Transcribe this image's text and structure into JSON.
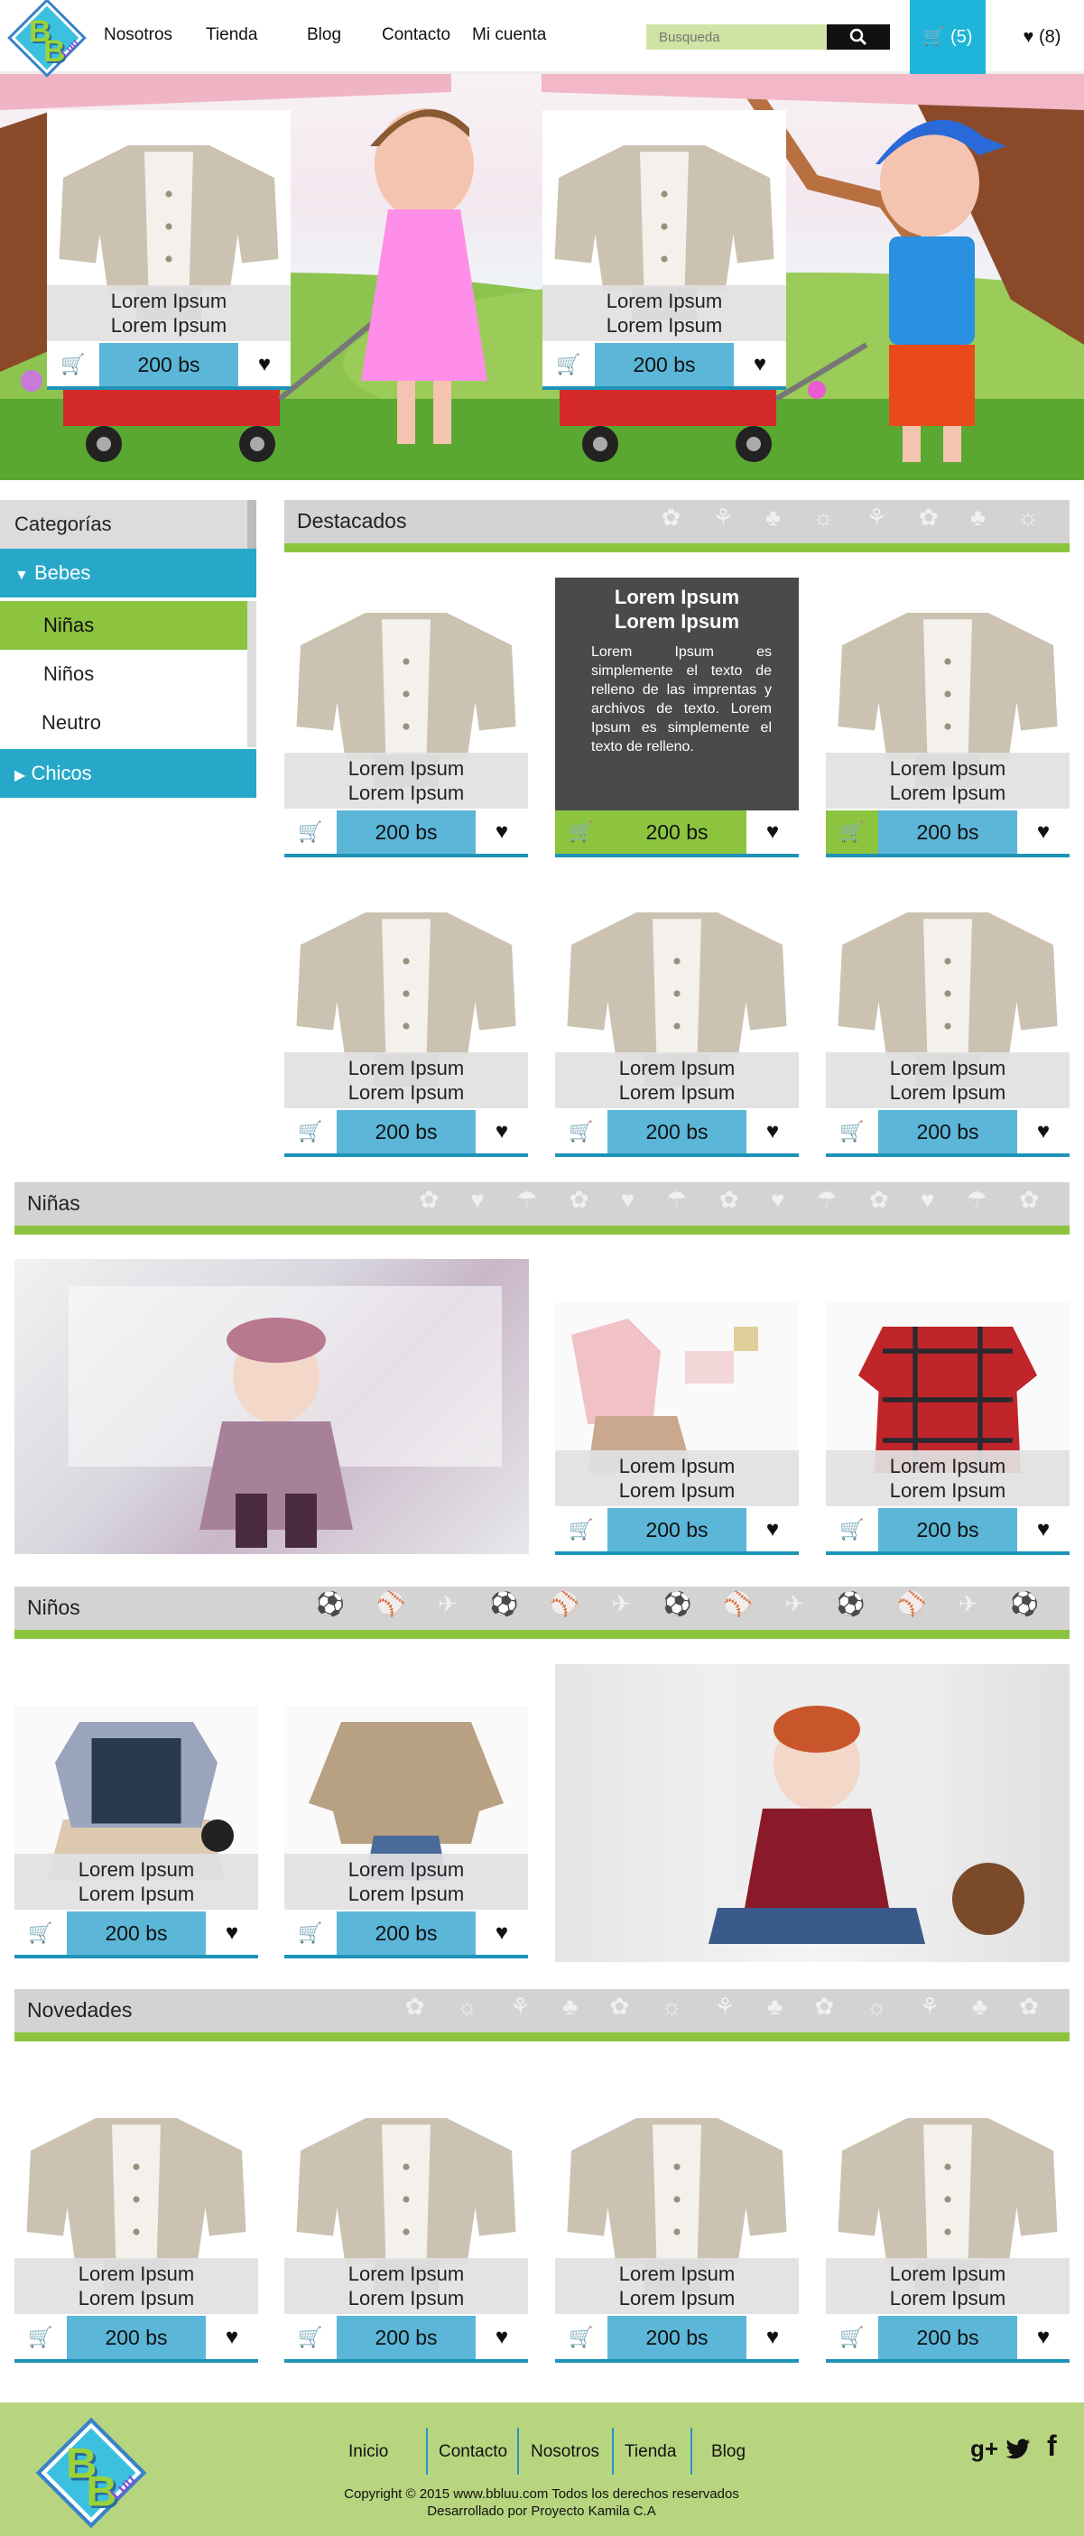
{
  "header": {
    "logo_text": "BBLuu",
    "nav": [
      "Nosotros",
      "Tienda",
      "Blog",
      "Contacto",
      "Mi cuenta"
    ],
    "search_placeholder": "Busqueda",
    "cart_count": "(5)",
    "fav_count": "(8)"
  },
  "hero": {
    "cards": [
      {
        "name1": "Lorem Ipsum",
        "name2": "Lorem Ipsum",
        "price": "200 bs"
      },
      {
        "name1": "Lorem Ipsum",
        "name2": "Lorem Ipsum",
        "price": "200 bs"
      }
    ]
  },
  "sidebar": {
    "title": "Categorías",
    "items": [
      {
        "label": "Bebes"
      },
      {
        "label": "Niñas"
      },
      {
        "label": "Niños"
      },
      {
        "label": "Neutro"
      },
      {
        "label": "Chicos"
      }
    ]
  },
  "destacados": {
    "title": "Destacados",
    "overlay_title1": "Lorem Ipsum",
    "overlay_title2": "Lorem Ipsum",
    "overlay_text": "Lorem Ipsum es simplemente el texto de relleno de las imprentas y archivos de texto. Lorem Ipsum es simplemente el texto de relleno.",
    "cards": [
      {
        "name1": "Lorem Ipsum",
        "name2": "Lorem Ipsum",
        "price": "200 bs"
      },
      {
        "name1": "Lorem Ipsum",
        "name2": "Lorem Ipsum",
        "price": "200 bs"
      },
      {
        "name1": "Lorem Ipsum",
        "name2": "Lorem Ipsum",
        "price": "200 bs"
      },
      {
        "name1": "Lorem Ipsum",
        "name2": "Lorem Ipsum",
        "price": "200 bs"
      },
      {
        "name1": "Lorem Ipsum",
        "name2": "Lorem Ipsum",
        "price": "200 bs"
      },
      {
        "name1": "Lorem Ipsum",
        "name2": "Lorem Ipsum",
        "price": "200 bs"
      }
    ]
  },
  "ninas": {
    "title": "Niñas",
    "cards": [
      {
        "name1": "Lorem Ipsum",
        "name2": "Lorem Ipsum",
        "price": "200 bs"
      },
      {
        "name1": "Lorem Ipsum",
        "name2": "Lorem Ipsum",
        "price": "200 bs"
      }
    ]
  },
  "ninos": {
    "title": "Niños",
    "cards": [
      {
        "name1": "Lorem Ipsum",
        "name2": "Lorem Ipsum",
        "price": "200 bs"
      },
      {
        "name1": "Lorem Ipsum",
        "name2": "Lorem Ipsum",
        "price": "200 bs"
      }
    ]
  },
  "novedades": {
    "title": "Novedades",
    "cards": [
      {
        "name1": "Lorem Ipsum",
        "name2": "Lorem Ipsum",
        "price": "200 bs"
      },
      {
        "name1": "Lorem Ipsum",
        "name2": "Lorem Ipsum",
        "price": "200 bs"
      },
      {
        "name1": "Lorem Ipsum",
        "name2": "Lorem Ipsum",
        "price": "200 bs"
      },
      {
        "name1": "Lorem Ipsum",
        "name2": "Lorem Ipsum",
        "price": "200 bs"
      }
    ]
  },
  "footer": {
    "nav": [
      "Inicio",
      "Contacto",
      "Nosotros",
      "Tienda",
      "Blog"
    ],
    "copyright": "Copyright © 2015 www.bbluu.com Todos los derechos reservados",
    "developer": "Desarrollado por Proyecto Kamila C.A"
  },
  "colors": {
    "blue": "#1fb4d9",
    "price_blue": "#5bb6d8",
    "green": "#8cc43f",
    "footer": "#b7d57f"
  },
  "icons": [
    "search-icon",
    "cart-icon",
    "heart-icon",
    "googleplus-icon",
    "twitter-icon",
    "facebook-icon",
    "triangle-icon"
  ]
}
